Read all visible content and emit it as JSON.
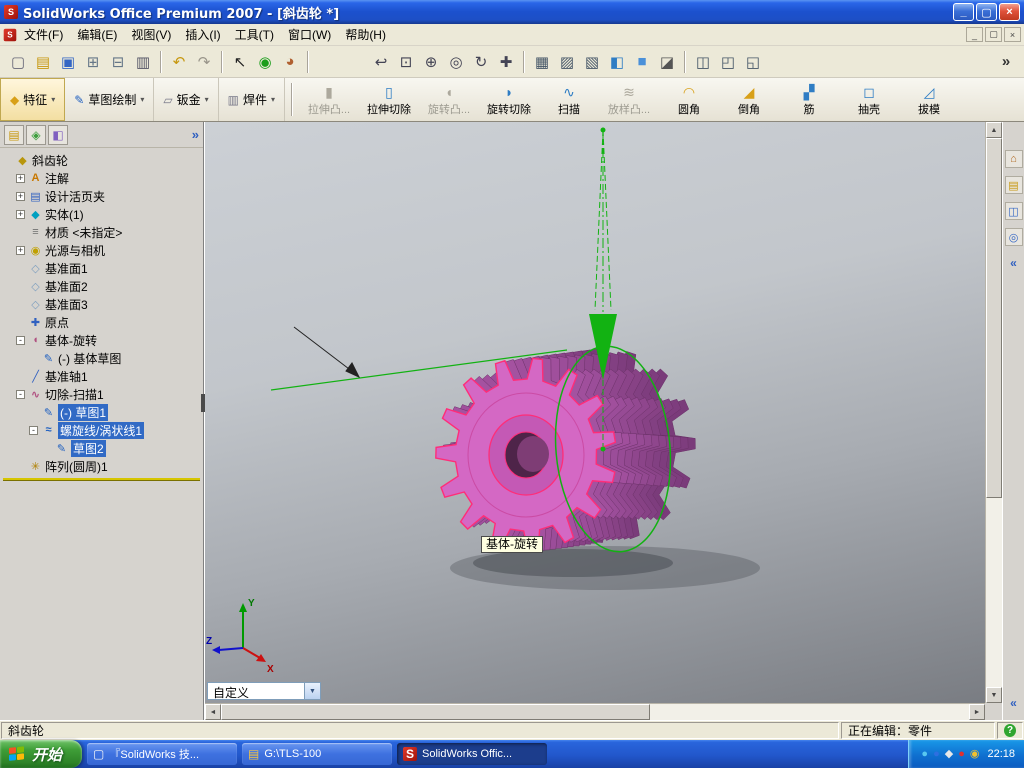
{
  "colors": {
    "selection_blue": "#316AC5",
    "gear_pink": "#D468C4",
    "gear_purple": "#7A3B7A",
    "edge_highlight": "#FF2D78",
    "helix_green": "#12B212",
    "taskbar_blue": "#245EDC",
    "start_green": "#3F9E38"
  },
  "window": {
    "title": "SolidWorks Office Premium 2007 - [斜齿轮 *]"
  },
  "menu": {
    "items": [
      {
        "label": "文件(F)"
      },
      {
        "label": "编辑(E)"
      },
      {
        "label": "视图(V)"
      },
      {
        "label": "插入(I)"
      },
      {
        "label": "工具(T)"
      },
      {
        "label": "窗口(W)"
      },
      {
        "label": "帮助(H)"
      }
    ]
  },
  "toolbar": {
    "items": [
      {
        "kind": "btn",
        "name": "new-button"
      },
      {
        "kind": "btn",
        "name": "open-button"
      },
      {
        "kind": "btn",
        "name": "save-button"
      },
      {
        "kind": "btn",
        "name": "make-drawing-button"
      },
      {
        "kind": "btn",
        "name": "make-assembly-button"
      },
      {
        "kind": "btn",
        "name": "print-button"
      },
      {
        "kind": "sep"
      },
      {
        "kind": "btn",
        "name": "undo-button"
      },
      {
        "kind": "btn",
        "name": "redo-button"
      },
      {
        "kind": "sep"
      },
      {
        "kind": "btn",
        "name": "select-button"
      },
      {
        "kind": "btn",
        "name": "rebuild-button"
      },
      {
        "kind": "btn",
        "name": "edit-color-button"
      },
      {
        "kind": "sep"
      },
      {
        "kind": "spacer"
      },
      {
        "kind": "btn",
        "name": "view-previous-button"
      },
      {
        "kind": "btn",
        "name": "zoom-area-button"
      },
      {
        "kind": "btn",
        "name": "zoom-in-out-button"
      },
      {
        "kind": "btn",
        "name": "zoom-fit-button"
      },
      {
        "kind": "btn",
        "name": "rotate-view-button"
      },
      {
        "kind": "btn",
        "name": "pan-button"
      },
      {
        "kind": "sep"
      },
      {
        "kind": "btn",
        "name": "wireframe-button"
      },
      {
        "kind": "btn",
        "name": "hidden-lines-visible-button"
      },
      {
        "kind": "btn",
        "name": "hidden-lines-removed-button"
      },
      {
        "kind": "btn",
        "name": "shaded-with-edges-button"
      },
      {
        "kind": "btn",
        "name": "shaded-button"
      },
      {
        "kind": "btn",
        "name": "shadows-button"
      },
      {
        "kind": "sep"
      },
      {
        "kind": "btn",
        "name": "section-view-button"
      },
      {
        "kind": "btn",
        "name": "standard-views-button"
      },
      {
        "kind": "btn",
        "name": "view-orientation-button"
      },
      {
        "kind": "btn",
        "name": "toolbar-overflow-button"
      }
    ]
  },
  "command_manager": {
    "tabs": [
      {
        "label": "特征",
        "name": "tab-features",
        "state": "active"
      },
      {
        "label": "草图绘制",
        "name": "tab-sketch",
        "state": ""
      },
      {
        "label": "钣金",
        "name": "tab-sheet-metal",
        "state": ""
      },
      {
        "label": "焊件",
        "name": "tab-weldments",
        "state": ""
      }
    ],
    "buttons": [
      {
        "label": "拉伸凸...",
        "name": "extrude-boss-button",
        "state": "disabled"
      },
      {
        "label": "拉伸切除",
        "name": "extrude-cut-button",
        "state": ""
      },
      {
        "label": "旋转凸...",
        "name": "revolve-boss-button",
        "state": "disabled"
      },
      {
        "label": "旋转切除",
        "name": "revolve-cut-button",
        "state": ""
      },
      {
        "label": "扫描",
        "name": "sweep-button",
        "state": ""
      },
      {
        "label": "放样凸...",
        "name": "loft-boss-button",
        "state": "disabled"
      },
      {
        "label": "圆角",
        "name": "fillet-button",
        "state": ""
      },
      {
        "label": "倒角",
        "name": "chamfer-button",
        "state": ""
      },
      {
        "label": "筋",
        "name": "rib-button",
        "state": ""
      },
      {
        "label": "抽壳",
        "name": "shell-button",
        "state": ""
      },
      {
        "label": "拔模",
        "name": "draft-button",
        "state": ""
      }
    ]
  },
  "feature_panel": {
    "tabs": [
      {
        "name": "feature-tree-tab-icon"
      },
      {
        "name": "property-manager-tab-icon"
      },
      {
        "name": "configuration-tab-icon"
      }
    ]
  },
  "tree": {
    "items": [
      {
        "indent": 0,
        "marker": "",
        "icon": "part-icon",
        "label": "斜齿轮",
        "state": ""
      },
      {
        "indent": 1,
        "marker": "+",
        "icon": "annotations-icon",
        "label": "注解",
        "state": ""
      },
      {
        "indent": 1,
        "marker": "+",
        "icon": "design-binder-icon",
        "label": "设计活页夹",
        "state": ""
      },
      {
        "indent": 1,
        "marker": "+",
        "icon": "solid-bodies-icon",
        "label": "实体(1)",
        "state": ""
      },
      {
        "indent": 1,
        "marker": "",
        "icon": "material-icon",
        "label": "材质 <未指定>",
        "state": ""
      },
      {
        "indent": 1,
        "marker": "+",
        "icon": "lights-icon",
        "label": "光源与相机",
        "state": ""
      },
      {
        "indent": 1,
        "marker": "",
        "icon": "plane-icon",
        "label": "基准面1",
        "state": ""
      },
      {
        "indent": 1,
        "marker": "",
        "icon": "plane-icon",
        "label": "基准面2",
        "state": ""
      },
      {
        "indent": 1,
        "marker": "",
        "icon": "plane-icon",
        "label": "基准面3",
        "state": ""
      },
      {
        "indent": 1,
        "marker": "",
        "icon": "origin-icon",
        "label": "原点",
        "state": ""
      },
      {
        "indent": 1,
        "marker": "-",
        "icon": "revolve-icon",
        "label": "基体-旋转",
        "state": ""
      },
      {
        "indent": 2,
        "marker": "",
        "icon": "sketch-icon",
        "label": "(-) 基体草图",
        "state": ""
      },
      {
        "indent": 1,
        "marker": "",
        "icon": "axis-icon",
        "label": "基准轴1",
        "state": ""
      },
      {
        "indent": 1,
        "marker": "-",
        "icon": "cut-sweep-icon",
        "label": "切除-扫描1",
        "state": ""
      },
      {
        "indent": 2,
        "marker": "",
        "icon": "sketch-icon",
        "label": "(-) 草图1",
        "state": "selected"
      },
      {
        "indent": 2,
        "marker": "-",
        "icon": "helix-icon",
        "label": "螺旋线/涡状线1",
        "state": "selected"
      },
      {
        "indent": 3,
        "marker": "",
        "icon": "sketch-icon",
        "label": "草图2",
        "state": "selected"
      },
      {
        "indent": 1,
        "marker": "",
        "icon": "circular-pattern-icon",
        "label": "阵列(圆周)1",
        "state": ""
      }
    ]
  },
  "viewport": {
    "tooltip": "基体-旋转",
    "view_combo": "自定义",
    "triad": {
      "x": "X",
      "y": "Y",
      "z": "Z"
    }
  },
  "task_pane": {
    "icons": [
      {
        "name": "resources-icon"
      },
      {
        "name": "design-library-icon"
      },
      {
        "name": "file-explorer-icon"
      },
      {
        "name": "search-icon"
      }
    ]
  },
  "status": {
    "left": "斜齿轮",
    "editing": "正在编辑：零件"
  },
  "taskbar": {
    "start": "开始",
    "tasks": [
      {
        "label": "『SolidWorks 技...",
        "name": "task-solidworks-doc",
        "icon": "document-icon",
        "state": ""
      },
      {
        "label": "G:\\TLS-100",
        "name": "task-explorer-tls100",
        "icon": "folder-icon",
        "state": ""
      },
      {
        "label": "SolidWorks Offic...",
        "name": "task-solidworks-app",
        "icon": "solidworks-icon",
        "state": "active"
      }
    ],
    "tray_icons": [
      {
        "name": "tray-icon-1"
      },
      {
        "name": "tray-icon-2"
      },
      {
        "name": "tray-icon-3"
      },
      {
        "name": "tray-icon-4"
      },
      {
        "name": "tray-icon-5"
      }
    ],
    "clock": "22:18"
  }
}
